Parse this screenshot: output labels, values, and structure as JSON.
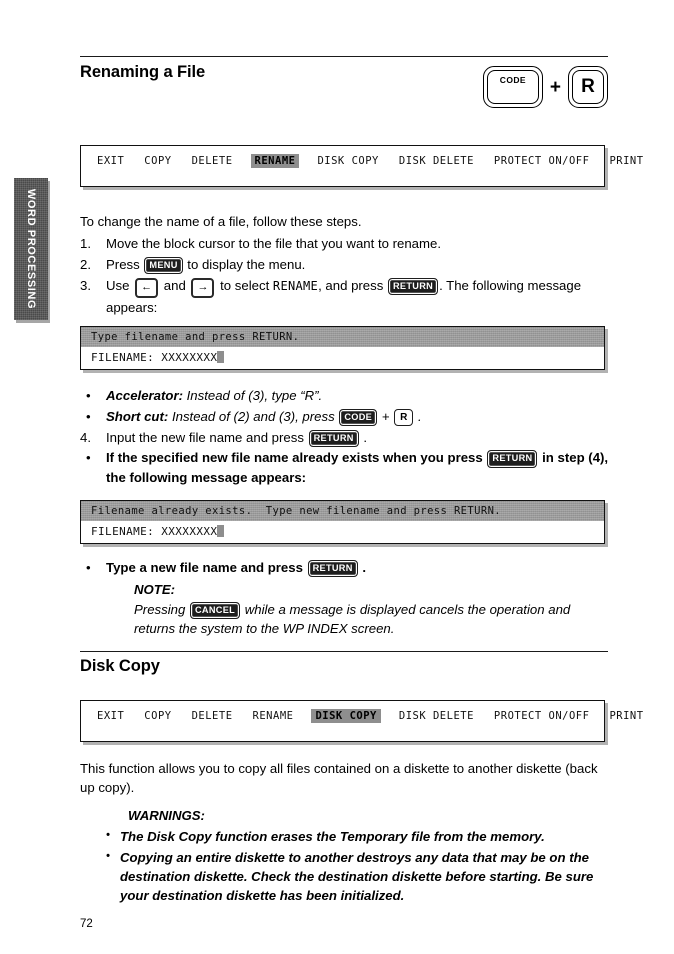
{
  "side_tab": {
    "label": "WORD PROCESSING"
  },
  "sections": {
    "rename": {
      "title": "Renaming a File",
      "keycaps": {
        "code": "CODE",
        "plus": "+",
        "letter": "R"
      },
      "intro": "To change the name of a file, follow these steps.",
      "menu": {
        "items": [
          "EXIT",
          "COPY",
          "DELETE",
          "RENAME",
          "DISK COPY",
          "DISK DELETE",
          "PROTECT ON/OFF",
          "PRINT"
        ],
        "selected": "RENAME"
      },
      "steps": [
        {
          "num": "1.",
          "text": "Move the block cursor to the file that you want to rename."
        },
        {
          "num": "2.",
          "pre": "Press ",
          "key": "MENU",
          "post": " to display the menu."
        },
        {
          "num": "3.",
          "pre": "Use ",
          "key_left": "←",
          "mid": " and ",
          "key_right": "→",
          "mid2": " to select ",
          "target": "RENAME",
          "mid3": ", and press ",
          "key": "RETURN",
          "post": ". The following message appears:"
        }
      ],
      "screen_prompt": {
        "message": "Type filename and press RETURN.",
        "field": "FILENAME: XXXXXXXX"
      },
      "notes": [
        {
          "bullet": "•",
          "lead": "Accelerator:",
          "text": " Instead of (3), type “R”."
        },
        {
          "bullet": "•",
          "lead": "Short cut:",
          "text_pre": " Instead of (2) and (3), press ",
          "key1": "CODE",
          "plus": " + ",
          "key2": "R",
          "text_post": " ."
        },
        {
          "num": "4.",
          "text_pre": "Input the new file name and press ",
          "key": "RETURN",
          "text_post": " ."
        },
        {
          "bullet": "•",
          "bold_pre": "If the specified new file name already exists when you press ",
          "key": "RETURN",
          "bold_post": " in step (4), the following message appears:"
        }
      ],
      "screen_exists": {
        "message": "Filename already exists.  Type new filename and press RETURN.",
        "field": "FILENAME: XXXXXXXX"
      },
      "final_step": {
        "bullet": "•",
        "pre": "Type a new file name and press ",
        "key": "RETURN",
        "post": " ."
      },
      "note": {
        "label": "NOTE:",
        "body_pre": "Pressing ",
        "key": "CANCEL",
        "body_post": " while a message is displayed cancels the operation and returns the system to the WP INDEX screen."
      }
    },
    "disk_copy": {
      "title": "Disk Copy",
      "menu": {
        "items": [
          "EXIT",
          "COPY",
          "DELETE",
          "RENAME",
          "DISK COPY",
          "DISK DELETE",
          "PROTECT ON/OFF",
          "PRINT"
        ],
        "selected": "DISK COPY"
      },
      "intro": "This function allows you to copy all files contained on a diskette to another diskette (back up copy).",
      "warnings_label": "WARNINGS:",
      "warnings": [
        "The Disk Copy function erases the Temporary file from the memory.",
        "Copying an entire diskette to another destroys any data that may be on the destination diskette. Check the destination diskette before starting. Be sure your destination diskette has been initialized."
      ]
    }
  },
  "page_number": "72"
}
